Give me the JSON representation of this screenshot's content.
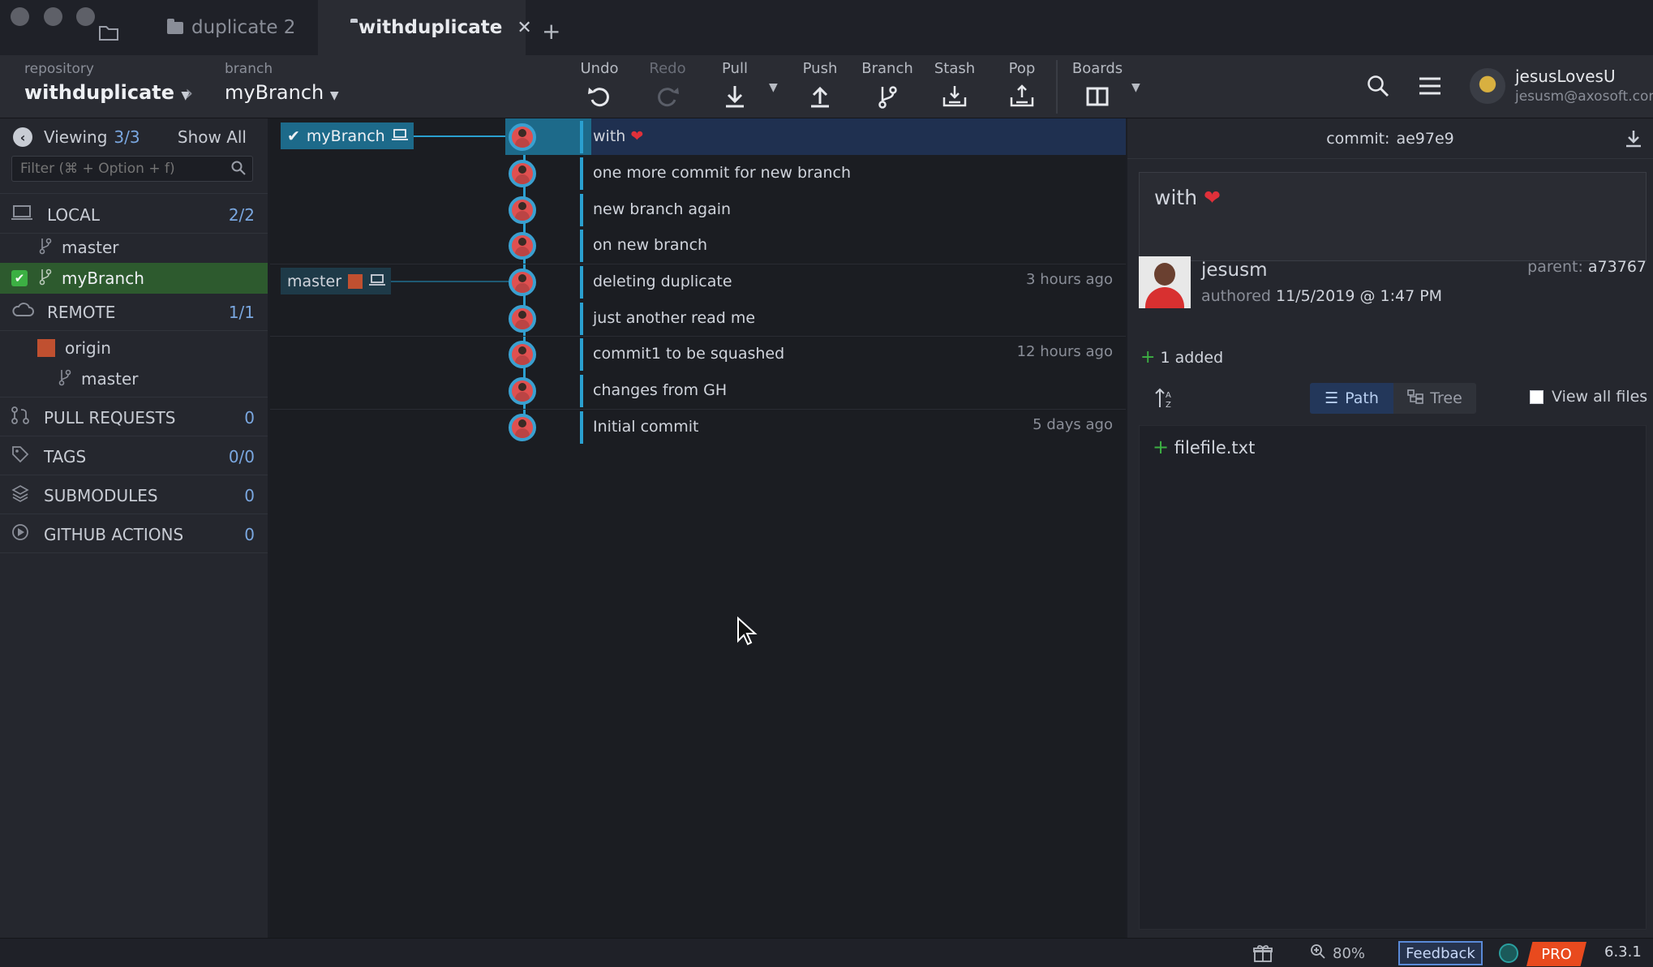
{
  "tabs": [
    {
      "label": "duplicate 2"
    },
    {
      "label": "withduplicate"
    }
  ],
  "toolbar": {
    "repo_label": "repository",
    "repo_name": "withduplicate",
    "branch_label": "branch",
    "branch_name": "myBranch",
    "undo": "Undo",
    "redo": "Redo",
    "pull": "Pull",
    "push": "Push",
    "branch": "Branch",
    "stash": "Stash",
    "pop": "Pop",
    "boards": "Boards",
    "user_name": "jesusLovesU",
    "user_email": "jesusm@axosoft.com"
  },
  "sidebar": {
    "viewing_label": "Viewing",
    "viewing_count": "3/3",
    "show_all": "Show All",
    "filter_placeholder": "Filter (⌘ + Option + f)",
    "local_label": "LOCAL",
    "local_count": "2/2",
    "local_branches": [
      "master",
      "myBranch"
    ],
    "remote_label": "REMOTE",
    "remote_count": "1/1",
    "remote_name": "origin",
    "remote_branch": "master",
    "pull_requests_label": "PULL REQUESTS",
    "pull_requests_count": "0",
    "tags_label": "TAGS",
    "tags_count": "0/0",
    "submodules_label": "SUBMODULES",
    "submodules_count": "0",
    "actions_label": "GITHUB ACTIONS",
    "actions_count": "0"
  },
  "graph": {
    "branch_tag_1": "myBranch",
    "branch_tag_2": "master",
    "commits": [
      {
        "message": "with",
        "time": ""
      },
      {
        "message": "one more commit for new branch",
        "time": ""
      },
      {
        "message": "new branch again",
        "time": ""
      },
      {
        "message": "on new branch",
        "time": ""
      },
      {
        "message": "deleting duplicate",
        "time": "3 hours ago"
      },
      {
        "message": "just another read me",
        "time": ""
      },
      {
        "message": "commit1 to be squashed",
        "time": "12 hours ago"
      },
      {
        "message": "changes from GH",
        "time": ""
      },
      {
        "message": "Initial commit",
        "time": "5 days ago"
      }
    ]
  },
  "details": {
    "commit_label": "commit:",
    "commit_sha": "ae97e9",
    "message": "with",
    "author": "jesusm",
    "authored_label": "authored",
    "authored_date": "11/5/2019 @ 1:47 PM",
    "parent_label": "parent:",
    "parent_sha": "a73767",
    "added": "1 added",
    "path_label": "Path",
    "tree_label": "Tree",
    "view_all": "View all files",
    "files": [
      "filefile.txt"
    ]
  },
  "status": {
    "zoom": "80%",
    "feedback": "Feedback",
    "pro": "PRO",
    "version": "6.3.1"
  },
  "colors": {
    "accent": "#2aa0d0",
    "selected_branch": "#2d5a2e",
    "pro": "#e84a1e"
  }
}
